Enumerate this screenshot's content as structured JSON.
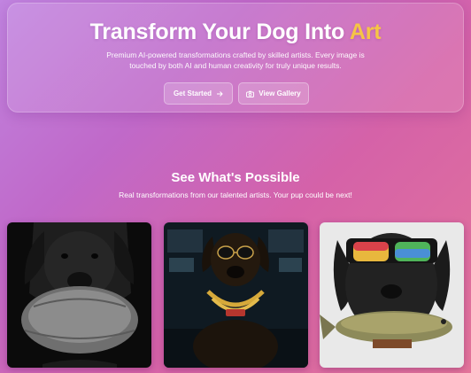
{
  "hero": {
    "title_main": "Transform Your Dog Into ",
    "title_accent": "Art",
    "description": "Premium AI-powered transformations crafted by skilled artists. Every image is touched by both AI and human creativity for truly unique results.",
    "primary_button": "Get Started",
    "secondary_button": "View Gallery"
  },
  "gallery": {
    "title": "See What's Possible",
    "subtitle": "Real transformations from our talented artists. Your pup could be next!",
    "items": [
      {
        "icon": "dog-with-football-image"
      },
      {
        "icon": "dog-with-sunglasses-and-gold-chain-image"
      },
      {
        "icon": "dog-with-goggles-and-fish-image"
      }
    ]
  },
  "colors": {
    "accent": "#f6c545",
    "background_start": "#c184e0",
    "background_end": "#e3749a"
  }
}
